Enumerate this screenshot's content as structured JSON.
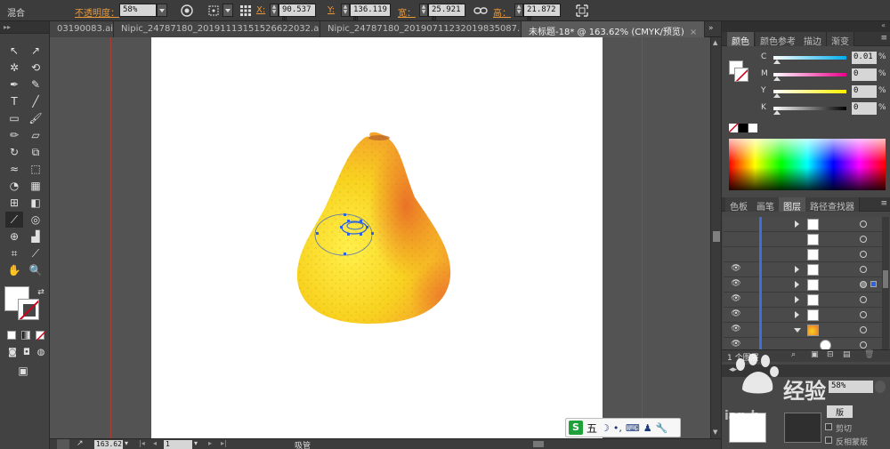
{
  "control_bar": {
    "mode_label": "混合",
    "opacity_label": "不透明度：",
    "opacity_value": "58%",
    "x_label": "X:",
    "x_value": "90.537 m",
    "y_label": "Y:",
    "y_value": "136.119 m",
    "w_label": "宽：",
    "w_value": "25.921 m",
    "h_label": "高：",
    "h_value": "21.872 m"
  },
  "tabs": [
    {
      "label": "03190083.ai*",
      "active": false
    },
    {
      "label": "Nipic_24787180_20191113151526622032.ai*",
      "active": false
    },
    {
      "label": "Nipic_24787180_20190711232019835087.ai*",
      "active": false
    },
    {
      "label": "未标题-18* @ 163.62% (CMYK/预览)",
      "active": true
    }
  ],
  "tab_close_glyph": "×",
  "status_bar": {
    "zoom": "163.62",
    "page": "1",
    "tool_name": "吸管"
  },
  "ime": {
    "badge": "S",
    "mode": "五"
  },
  "color_panel": {
    "tabs": [
      "颜色",
      "颜色参考",
      "描边",
      "渐变"
    ],
    "channels": [
      {
        "name": "C",
        "value": "0.01"
      },
      {
        "name": "M",
        "value": "0"
      },
      {
        "name": "Y",
        "value": "0"
      },
      {
        "name": "K",
        "value": "0"
      }
    ],
    "percent_sign": "%"
  },
  "layers_panel": {
    "tabs": [
      "色板",
      "画笔",
      "图层",
      "路径查找器"
    ],
    "footer_count": "1 个图层",
    "rows": [
      {
        "visible": false,
        "arrow": "right",
        "selected": false
      },
      {
        "visible": false,
        "arrow": "none",
        "selected": false
      },
      {
        "visible": false,
        "arrow": "none",
        "selected": false
      },
      {
        "visible": true,
        "arrow": "right",
        "selected": false
      },
      {
        "visible": true,
        "arrow": "right",
        "selected": true
      },
      {
        "visible": true,
        "arrow": "right",
        "selected": false
      },
      {
        "visible": true,
        "arrow": "right",
        "selected": false
      },
      {
        "visible": true,
        "arrow": "down",
        "selected": false
      },
      {
        "visible": true,
        "arrow": "none",
        "selected": false
      }
    ]
  },
  "transparency_panel": {
    "opacity_value": "58%",
    "button": "版",
    "opt_clip": "剪切",
    "opt_invert": "反相蒙版"
  },
  "watermark": {
    "text": "经验",
    "site": "ian.b"
  },
  "colors": {
    "accent_orange": "#e9983a",
    "selection_blue": "#2d63e0",
    "guide_red": "#c0392b"
  }
}
